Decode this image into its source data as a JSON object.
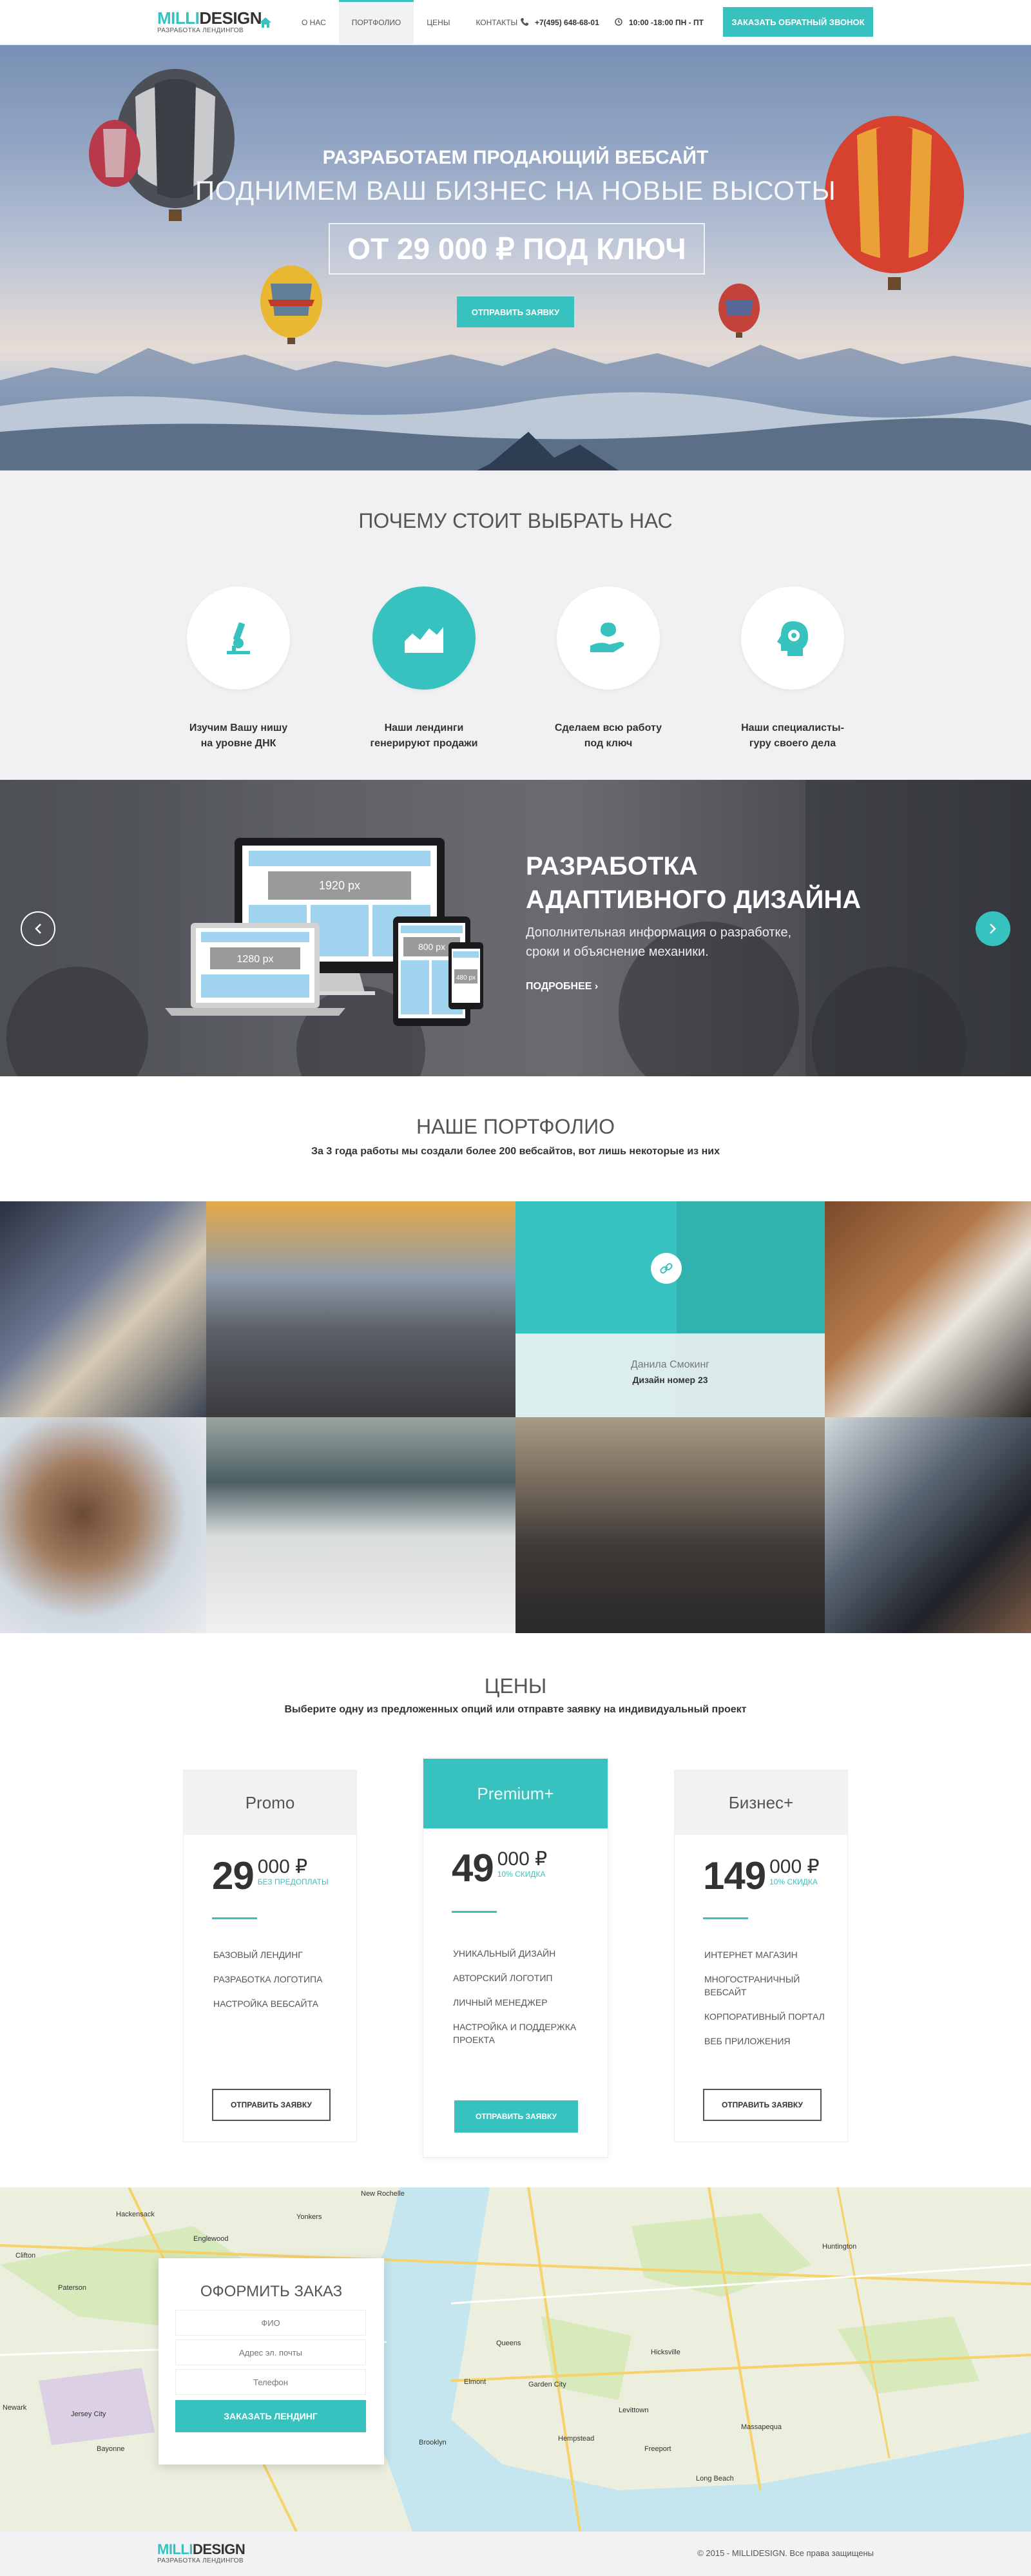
{
  "header": {
    "logo_a": "MILLI",
    "logo_b": "DESIGN",
    "logo_sub": "РАЗРАБОТКА ЛЕНДИНГОВ",
    "nav": [
      "О НАС",
      "ПОРТФОЛИО",
      "ЦЕНЫ",
      "КОНТАКТЫ"
    ],
    "phone": "+7(495) 648-68-01",
    "hours": "10:00 -18:00 ПН - ПТ",
    "cta": "ЗАКАЗАТЬ ОБРАТНЫЙ ЗВОНОК"
  },
  "hero": {
    "line1": "РАЗРАБОТАЕМ ПРОДАЮЩИЙ ВЕБСАЙТ",
    "line2": "ПОДНИМЕМ ВАШ БИЗНЕС НА НОВЫЕ ВЫСОТЫ",
    "price": "ОТ 29 000 ₽  ПОД КЛЮЧ",
    "button": "ОТПРАВИТЬ ЗАЯВКУ"
  },
  "why": {
    "title": "ПОЧЕМУ СТОИТ ВЫБРАТЬ НАС",
    "items": [
      {
        "text": "Изучим Вашу нишу\nна уровне ДНК",
        "icon": "microscope-icon"
      },
      {
        "text": "Наши лендинги\nгенерируют продажи",
        "icon": "chart-icon"
      },
      {
        "text": "Сделаем всю работу\nпод ключ",
        "icon": "hand-icon"
      },
      {
        "text": "Наши специалисты-\nгуру своего дела",
        "icon": "head-gear-icon"
      }
    ]
  },
  "slider": {
    "title": "РАЗРАБОТКА\nАДАПТИВНОГО ДИЗАЙНА",
    "desc": "Дополнительная информация о разработке, сроки и объяснение механики.",
    "more": "ПОДРОБНЕЕ",
    "screens": [
      "1920 px",
      "1280 px",
      "800 px",
      "480 px"
    ]
  },
  "portfolio": {
    "title": "НАШЕ ПОРТФОЛИО",
    "subtitle": "За 3 года работы мы создали более 200 вебсайтов, вот лишь некоторые из них",
    "hover_name": "Данила Смокинг",
    "hover_caption": "Дизайн номер 23"
  },
  "pricing": {
    "title": "ЦЕНЫ",
    "subtitle": "Выберите одну из предложенных опций или отправте заявку на индивидуальный проект",
    "cards": [
      {
        "name": "Promo",
        "big": "29",
        "thou": "000 ₽",
        "note": "БЕЗ ПРЕДОПЛАТЫ",
        "features": [
          "БАЗОВЫЙ ЛЕНДИНГ",
          "РАЗРАБОТКА ЛОГОТИПА",
          "НАСТРОЙКА ВЕБСАЙТА"
        ],
        "button": "ОТПРАВИТЬ ЗАЯВКУ"
      },
      {
        "name": "Premium+",
        "big": "49",
        "thou": "000 ₽",
        "note": "10% СКИДКА",
        "features": [
          "УНИКАЛЬНЫЙ ДИЗАЙН",
          "АВТОРСКИЙ ЛОГОТИП",
          "ЛИЧНЫЙ МЕНЕДЖЕР",
          "НАСТРОЙКА И ПОДДЕРЖКА\nПРОЕКТА"
        ],
        "button": "ОТПРАВИТЬ ЗАЯВКУ"
      },
      {
        "name": "Бизнес+",
        "big": "149",
        "thou": "000 ₽",
        "note": "10% СКИДКА",
        "features": [
          "ИНТЕРНЕТ МАГАЗИН",
          "МНОГОСТРАНИЧНЫЙ\nВЕБСАЙТ",
          "КОРПОРАТИВНЫЙ ПОРТАЛ",
          "ВЕБ ПРИЛОЖЕНИЯ"
        ],
        "button": "ОТПРАВИТЬ ЗАЯВКУ"
      }
    ]
  },
  "order": {
    "title": "ОФОРМИТЬ ЗАКАЗ",
    "name_placeholder": "ФИО",
    "email_placeholder": "Адрес эл. почты",
    "phone_placeholder": "Телефон",
    "button": "ЗАКАЗАТЬ ЛЕНДИНГ"
  },
  "map_labels": [
    "New Rochelle",
    "Hackensack",
    "Clifton",
    "Englewood",
    "Paterson",
    "Yonkers",
    "Huntington",
    "Jersey City",
    "Newark",
    "Brooklyn",
    "Queens",
    "Hempstead",
    "Levittown",
    "Hicksville",
    "Long Beach",
    "Freeport",
    "Massapequa",
    "Garden City",
    "Elmont",
    "Bayonne"
  ],
  "footer": {
    "copyright": "© 2015 - MILLIDESIGN. Все права защищены"
  },
  "colors": {
    "accent": "#37c2bf",
    "text": "#333333",
    "muted": "#f2f2f4"
  }
}
